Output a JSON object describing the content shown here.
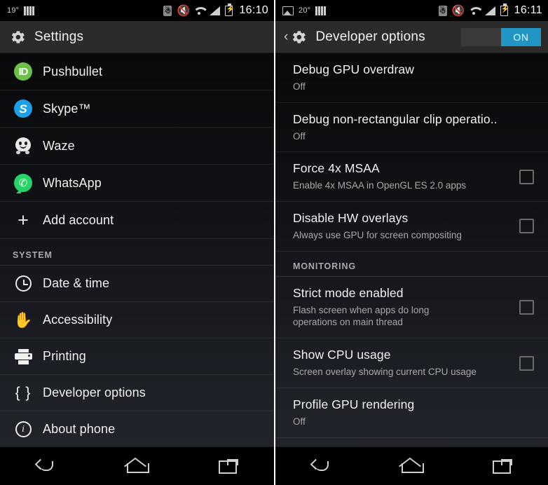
{
  "left": {
    "statusbar": {
      "temperature": "19°",
      "clock": "16:10",
      "icons": [
        "bars-icon",
        "bluetooth-icon",
        "mute-icon",
        "wifi-icon",
        "signal-icon",
        "battery-icon"
      ]
    },
    "actionbar": {
      "title": "Settings",
      "icon": "gear-icon"
    },
    "accounts": [
      {
        "label": "Pushbullet",
        "icon": "pushbullet-icon",
        "glyph": "ID"
      },
      {
        "label": "Skype™",
        "icon": "skype-icon",
        "glyph": "S"
      },
      {
        "label": "Waze",
        "icon": "waze-icon",
        "glyph": ""
      },
      {
        "label": "WhatsApp",
        "icon": "whatsapp-icon",
        "glyph": "✆"
      },
      {
        "label": "Add account",
        "icon": "plus-icon",
        "glyph": "+"
      }
    ],
    "system_header": "SYSTEM",
    "system": [
      {
        "label": "Date & time",
        "icon": "clock-icon"
      },
      {
        "label": "Accessibility",
        "icon": "hand-icon",
        "glyph": "✋"
      },
      {
        "label": "Printing",
        "icon": "printer-icon"
      },
      {
        "label": "Developer options",
        "icon": "braces-icon",
        "glyph": "{ }"
      },
      {
        "label": "About phone",
        "icon": "info-icon",
        "glyph": "i"
      }
    ],
    "navbar": [
      "back-icon",
      "home-icon",
      "recents-icon"
    ]
  },
  "right": {
    "statusbar": {
      "temperature": "20°",
      "clock": "16:11",
      "icons": [
        "photo-icon",
        "bars-icon",
        "bluetooth-icon",
        "mute-icon",
        "wifi-icon",
        "signal-icon",
        "battery-icon"
      ]
    },
    "actionbar": {
      "title": "Developer options",
      "icon": "gear-icon",
      "back": "‹",
      "toggle_label": "ON",
      "toggle_on": true,
      "toggle_color": "#2196c4"
    },
    "options": [
      {
        "title": "Debug GPU overdraw",
        "summary": "Off",
        "checkbox": false
      },
      {
        "title": "Debug non-rectangular clip operatio..",
        "summary": "Off",
        "checkbox": false
      },
      {
        "title": "Force 4x MSAA",
        "summary": "Enable 4x MSAA in OpenGL ES 2.0 apps",
        "checkbox": true
      },
      {
        "title": "Disable HW overlays",
        "summary": "Always use GPU for screen compositing",
        "checkbox": true
      }
    ],
    "monitoring_header": "MONITORING",
    "monitoring": [
      {
        "title": "Strict mode enabled",
        "summary": "Flash screen when apps do long operations on main thread",
        "checkbox": true
      },
      {
        "title": "Show CPU usage",
        "summary": "Screen overlay showing current CPU usage",
        "checkbox": true
      },
      {
        "title": "Profile GPU rendering",
        "summary": "Off",
        "checkbox": false
      }
    ],
    "navbar": [
      "back-icon",
      "home-icon",
      "recents-icon"
    ]
  }
}
